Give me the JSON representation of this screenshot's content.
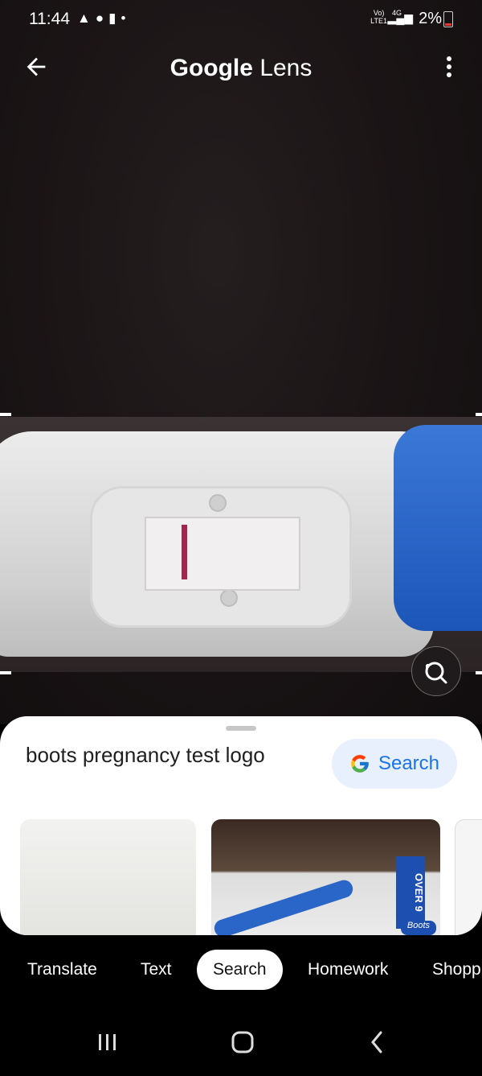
{
  "status_bar": {
    "time": "11:44",
    "notification_icons": [
      "warning-icon",
      "leaf-icon",
      "lock-icon",
      "dot-icon"
    ],
    "network_label_top": "Vo)",
    "network_label_bottom": "LTE1",
    "network_type": "4G",
    "battery_percent": "2%",
    "battery_level": 0.02
  },
  "top_bar": {
    "title_brand": "Google",
    "title_product": "Lens"
  },
  "result_sheet": {
    "query": "boots pregnancy test logo",
    "search_button_label": "Search"
  },
  "modes": [
    {
      "label": "Translate",
      "active": false
    },
    {
      "label": "Text",
      "active": false
    },
    {
      "label": "Search",
      "active": true
    },
    {
      "label": "Homework",
      "active": false
    },
    {
      "label": "Shopp",
      "active": false
    }
  ],
  "thumbnail_texts": {
    "label_over": "OVER 9",
    "label_brand": "Boots"
  },
  "colors": {
    "accent_blue": "#1a73e8",
    "search_pill_bg": "#e8f0fe",
    "test_line": "#a3274d",
    "device_cap": "#2a66c8"
  }
}
